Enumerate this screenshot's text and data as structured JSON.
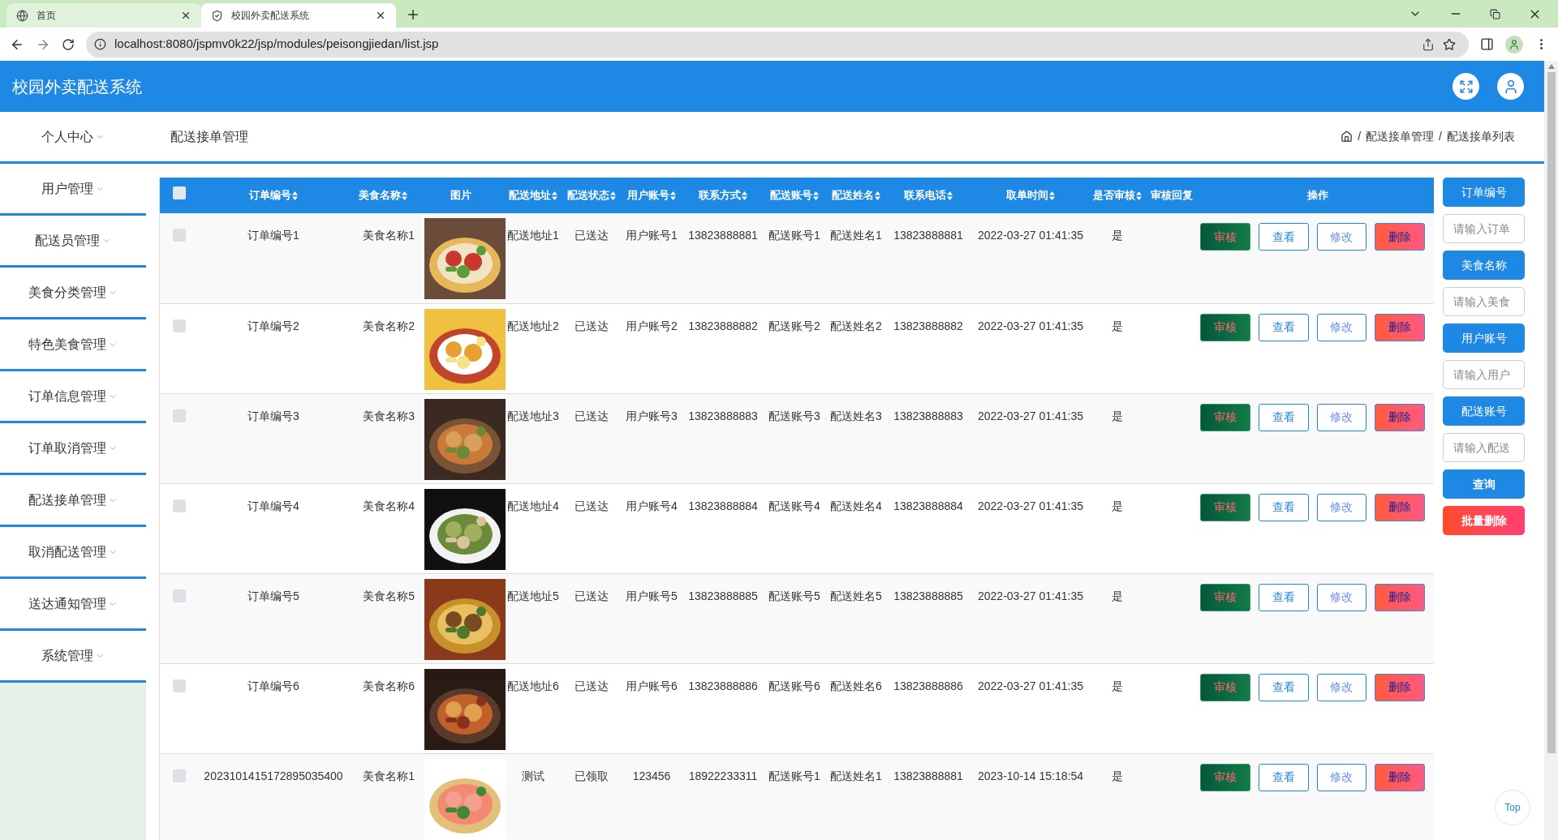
{
  "browser": {
    "tabs": [
      {
        "title": "首页",
        "selected": false
      },
      {
        "title": "校园外卖配送系统",
        "selected": true
      }
    ],
    "url": "localhost:8080/jspmv0k22/jsp/modules/peisongjiedan/list.jsp"
  },
  "header": {
    "title": "校园外卖配送系统"
  },
  "sidebar": {
    "items": [
      {
        "label": "个人中心"
      },
      {
        "label": "用户管理"
      },
      {
        "label": "配送员管理"
      },
      {
        "label": "美食分类管理"
      },
      {
        "label": "特色美食管理"
      },
      {
        "label": "订单信息管理"
      },
      {
        "label": "订单取消管理"
      },
      {
        "label": "配送接单管理"
      },
      {
        "label": "取消配送管理"
      },
      {
        "label": "送达通知管理"
      },
      {
        "label": "系统管理"
      }
    ]
  },
  "page": {
    "title": "配送接单管理",
    "breadcrumb": [
      {
        "separator": "/",
        "label": "配送接单管理"
      },
      {
        "separator": "/",
        "label": "配送接单列表"
      }
    ]
  },
  "table": {
    "select_all": {
      "checked": false
    },
    "columns": [
      {
        "label": "订单编号",
        "sortable": true
      },
      {
        "label": "美食名称",
        "sortable": true
      },
      {
        "label": "图片",
        "sortable": false
      },
      {
        "label": "配送地址",
        "sortable": true
      },
      {
        "label": "配送状态",
        "sortable": true
      },
      {
        "label": "用户账号",
        "sortable": true
      },
      {
        "label": "联系方式",
        "sortable": true
      },
      {
        "label": "配送账号",
        "sortable": true
      },
      {
        "label": "配送姓名",
        "sortable": true
      },
      {
        "label": "联系电话",
        "sortable": true
      },
      {
        "label": "取单时间",
        "sortable": true
      },
      {
        "label": "是否审核",
        "sortable": true
      },
      {
        "label": "审核回复",
        "sortable": false
      },
      {
        "label": "操作",
        "sortable": false
      }
    ],
    "rows": [
      {
        "checked": false,
        "cells": [
          "订单编号1",
          "美食名称1",
          {
            "kind": "picture"
          },
          "配送地址1",
          "已送达",
          "用户账号1",
          "13823888881",
          "配送账号1",
          "配送姓名1",
          "13823888881",
          "2022-03-27 01:41:35",
          "是"
        ],
        "actions": [
          {
            "label": "审核",
            "kind": "review"
          },
          {
            "label": "查看",
            "kind": "view"
          },
          {
            "label": "修改",
            "kind": "edit"
          },
          {
            "label": "删除",
            "kind": "delete"
          }
        ]
      },
      {
        "checked": false,
        "cells": [
          "订单编号2",
          "美食名称2",
          {
            "kind": "picture"
          },
          "配送地址2",
          "已送达",
          "用户账号2",
          "13823888882",
          "配送账号2",
          "配送姓名2",
          "13823888882",
          "2022-03-27 01:41:35",
          "是"
        ],
        "actions": [
          {
            "label": "审核",
            "kind": "review"
          },
          {
            "label": "查看",
            "kind": "view"
          },
          {
            "label": "修改",
            "kind": "edit"
          },
          {
            "label": "删除",
            "kind": "delete"
          }
        ]
      },
      {
        "checked": false,
        "cells": [
          "订单编号3",
          "美食名称3",
          {
            "kind": "picture"
          },
          "配送地址3",
          "已送达",
          "用户账号3",
          "13823888883",
          "配送账号3",
          "配送姓名3",
          "13823888883",
          "2022-03-27 01:41:35",
          "是"
        ],
        "actions": [
          {
            "label": "审核",
            "kind": "review"
          },
          {
            "label": "查看",
            "kind": "view"
          },
          {
            "label": "修改",
            "kind": "edit"
          },
          {
            "label": "删除",
            "kind": "delete"
          }
        ]
      },
      {
        "checked": false,
        "cells": [
          "订单编号4",
          "美食名称4",
          {
            "kind": "picture"
          },
          "配送地址4",
          "已送达",
          "用户账号4",
          "13823888884",
          "配送账号4",
          "配送姓名4",
          "13823888884",
          "2022-03-27 01:41:35",
          "是"
        ],
        "actions": [
          {
            "label": "审核",
            "kind": "review"
          },
          {
            "label": "查看",
            "kind": "view"
          },
          {
            "label": "修改",
            "kind": "edit"
          },
          {
            "label": "删除",
            "kind": "delete"
          }
        ]
      },
      {
        "checked": false,
        "cells": [
          "订单编号5",
          "美食名称5",
          {
            "kind": "picture"
          },
          "配送地址5",
          "已送达",
          "用户账号5",
          "13823888885",
          "配送账号5",
          "配送姓名5",
          "13823888885",
          "2022-03-27 01:41:35",
          "是"
        ],
        "actions": [
          {
            "label": "审核",
            "kind": "review"
          },
          {
            "label": "查看",
            "kind": "view"
          },
          {
            "label": "修改",
            "kind": "edit"
          },
          {
            "label": "删除",
            "kind": "delete"
          }
        ]
      },
      {
        "checked": false,
        "cells": [
          "订单编号6",
          "美食名称6",
          {
            "kind": "picture"
          },
          "配送地址6",
          "已送达",
          "用户账号6",
          "13823888886",
          "配送账号6",
          "配送姓名6",
          "13823888886",
          "2022-03-27 01:41:35",
          "是"
        ],
        "actions": [
          {
            "label": "审核",
            "kind": "review"
          },
          {
            "label": "查看",
            "kind": "view"
          },
          {
            "label": "修改",
            "kind": "edit"
          },
          {
            "label": "删除",
            "kind": "delete"
          }
        ]
      },
      {
        "checked": false,
        "cells": [
          "2023101415172895035400",
          "美食名称1",
          {
            "kind": "picture"
          },
          "测试",
          "已领取",
          "123456",
          "18922233311",
          "配送账号1",
          "配送姓名1",
          "13823888881",
          "2023-10-14 15:18:54",
          "是"
        ],
        "actions": [
          {
            "label": "审核",
            "kind": "review"
          },
          {
            "label": "查看",
            "kind": "view"
          },
          {
            "label": "修改",
            "kind": "edit"
          },
          {
            "label": "删除",
            "kind": "delete"
          }
        ]
      }
    ]
  },
  "filters": [
    {
      "label": "订单编号",
      "placeholder": "请输入订单"
    },
    {
      "label": "美食名称",
      "placeholder": "请输入美食"
    },
    {
      "label": "用户账号",
      "placeholder": "请输入用户"
    },
    {
      "label": "配送账号",
      "placeholder": "请输入配送"
    }
  ],
  "filter_buttons": [
    {
      "label": "查询",
      "kind": "search"
    },
    {
      "label": "批量删除",
      "kind": "danger"
    }
  ],
  "back_to_top": "Top"
}
